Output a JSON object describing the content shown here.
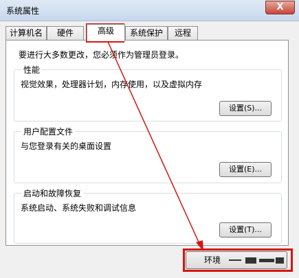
{
  "window": {
    "title": "系统属性",
    "close_label": "X"
  },
  "tabs": [
    {
      "label": "计算机名",
      "active": false
    },
    {
      "label": "硬件",
      "active": false
    },
    {
      "label": "高级",
      "active": true
    },
    {
      "label": "系统保护",
      "active": false
    },
    {
      "label": "远程",
      "active": false
    }
  ],
  "admin_note": "要进行大多数更改，您必须作为管理员登录。",
  "groups": {
    "performance": {
      "title": "性能",
      "desc": "视觉效果，处理器计划，内存使用，以及虚拟内存",
      "button": "设置(S)..."
    },
    "profile": {
      "title": "用户配置文件",
      "desc": "与您登录有关的桌面设置",
      "button": "设置(E)..."
    },
    "startup": {
      "title": "启动和故障恢复",
      "desc": "系统启动、系统失败和调试信息",
      "button": "设置(T)..."
    }
  },
  "env_button": {
    "label": "环境"
  },
  "colors": {
    "annotation_red": "#d6140f",
    "title_bg": "#c7d8ee",
    "close_red": "#c4473a"
  }
}
